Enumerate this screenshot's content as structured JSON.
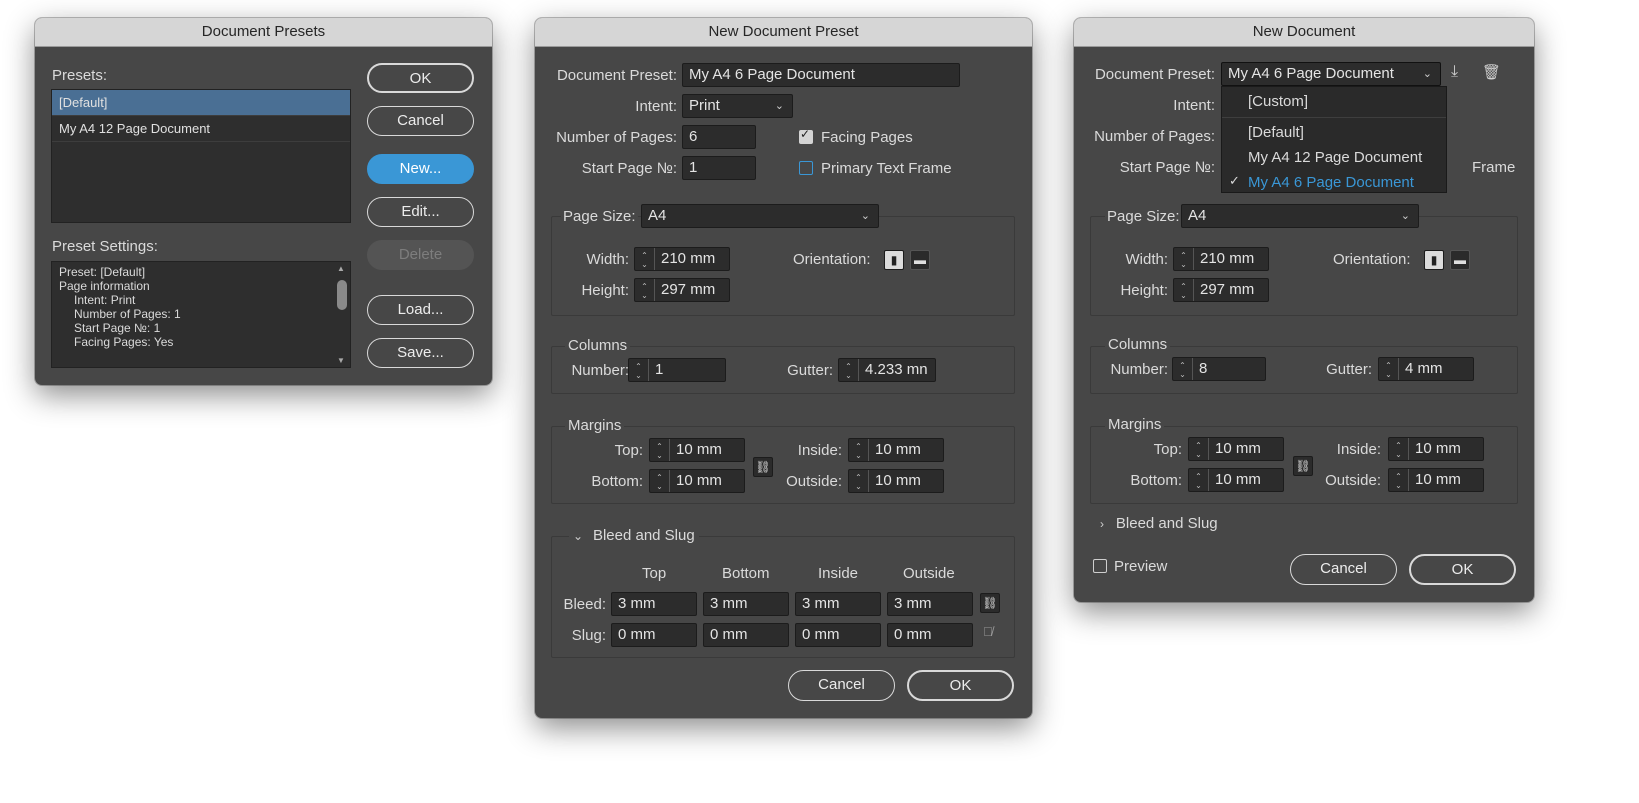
{
  "dialog1": {
    "title": "Document Presets",
    "presets_label": "Presets:",
    "presets": [
      "[Default]",
      "My A4 12 Page Document"
    ],
    "selected_index": 0,
    "settings_label": "Preset Settings:",
    "settings_lines": [
      "Preset: [Default]",
      "Page information",
      "Intent: Print",
      "Number of Pages: 1",
      "Start Page №: 1",
      "Facing Pages: Yes"
    ],
    "buttons": {
      "ok": "OK",
      "cancel": "Cancel",
      "new": "New...",
      "edit": "Edit...",
      "delete": "Delete",
      "load": "Load...",
      "save": "Save..."
    }
  },
  "dialog2": {
    "title": "New Document Preset",
    "preset_label": "Document Preset:",
    "preset_value": "My A4 6 Page Document",
    "intent_label": "Intent:",
    "intent_value": "Print",
    "pages_label": "Number of Pages:",
    "pages_value": "6",
    "start_label": "Start Page №:",
    "start_value": "1",
    "facing_label": "Facing Pages",
    "facing_checked": true,
    "primary_label": "Primary Text Frame",
    "primary_checked": false,
    "page_size_label": "Page Size:",
    "page_size_value": "A4",
    "width_label": "Width:",
    "width_value": "210 mm",
    "height_label": "Height:",
    "height_value": "297 mm",
    "orientation_label": "Orientation:",
    "columns_label": "Columns",
    "number_label": "Number:",
    "number_value": "1",
    "gutter_label": "Gutter:",
    "gutter_value": "4.233 mn",
    "margins_label": "Margins",
    "top_label": "Top:",
    "top_value": "10 mm",
    "bottom_label": "Bottom:",
    "bottom_value": "10 mm",
    "inside_label": "Inside:",
    "inside_value": "10 mm",
    "outside_label": "Outside:",
    "outside_value": "10 mm",
    "bleed_slug_label": "Bleed and Slug",
    "col_headers": [
      "Top",
      "Bottom",
      "Inside",
      "Outside"
    ],
    "bleed_label": "Bleed:",
    "bleed_values": [
      "3 mm",
      "3 mm",
      "3 mm",
      "3 mm"
    ],
    "slug_label": "Slug:",
    "slug_values": [
      "0 mm",
      "0 mm",
      "0 mm",
      "0 mm"
    ],
    "cancel": "Cancel",
    "ok": "OK"
  },
  "dialog3": {
    "title": "New Document",
    "preset_label": "Document Preset:",
    "preset_value": "My A4 6 Page Document",
    "intent_label": "Intent:",
    "pages_label": "Number of Pages:",
    "start_label": "Start Page №:",
    "frame_partial": "Frame",
    "dropdown_items": [
      "[Custom]",
      "[Default]",
      "My A4 12 Page Document",
      "My A4 6 Page Document"
    ],
    "dropdown_selected": 3,
    "page_size_label": "Page Size:",
    "page_size_value": "A4",
    "width_label": "Width:",
    "width_value": "210 mm",
    "height_label": "Height:",
    "height_value": "297 mm",
    "orientation_label": "Orientation:",
    "columns_label": "Columns",
    "number_label": "Number:",
    "number_value": "8",
    "gutter_label": "Gutter:",
    "gutter_value": "4 mm",
    "margins_label": "Margins",
    "top_label": "Top:",
    "top_value": "10 mm",
    "bottom_label": "Bottom:",
    "bottom_value": "10 mm",
    "inside_label": "Inside:",
    "inside_value": "10 mm",
    "outside_label": "Outside:",
    "outside_value": "10 mm",
    "bleed_slug_label": "Bleed and Slug",
    "preview_label": "Preview",
    "cancel": "Cancel",
    "ok": "OK"
  },
  "colors": {
    "accent": "#3a97d6",
    "dialog_bg": "#474747",
    "titlebar_bg": "#d6d6d6",
    "field_bg": "#2c2c2c"
  }
}
